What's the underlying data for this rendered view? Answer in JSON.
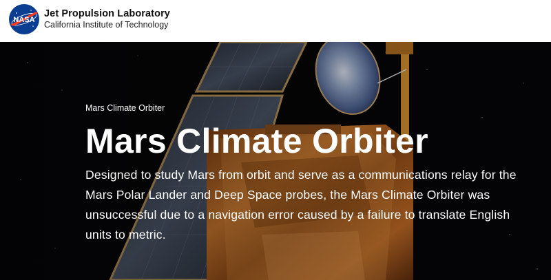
{
  "header": {
    "logo_text": "NASA",
    "org_name": "Jet Propulsion Laboratory",
    "org_sub": "California Institute of Technology"
  },
  "hero": {
    "eyebrow": "Mars Climate Orbiter",
    "title": "Mars Climate Orbiter",
    "description": "Designed to study Mars from orbit and serve as a communications relay for the Mars Polar Lander and Deep Space probes, the Mars Climate Orbiter was unsuccessful due to a navigation error caused by a failure to translate English units to metric."
  },
  "colors": {
    "nasa_blue": "#0b3d91",
    "nasa_red": "#fc3d21",
    "hero_text": "#ffffff",
    "header_bg": "#ffffff"
  },
  "icons": [
    "nasa-logo",
    "spacecraft-image"
  ]
}
